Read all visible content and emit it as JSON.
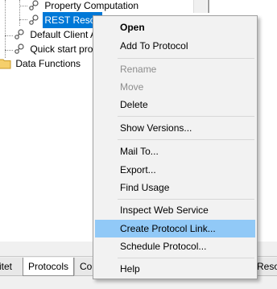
{
  "tree": {
    "items": [
      {
        "label": "Property Computation"
      },
      {
        "label": "REST Resou"
      },
      {
        "label": "Default Client A"
      },
      {
        "label": "Quick start pro"
      },
      {
        "label": "Data Functions"
      }
    ]
  },
  "tabs": [
    {
      "label": "itet"
    },
    {
      "label": "Protocols"
    },
    {
      "label": "Co"
    },
    {
      "label": "Resou"
    }
  ],
  "menu": {
    "items": [
      {
        "label": "Open"
      },
      {
        "label": "Add To Protocol"
      },
      {
        "label": "Rename"
      },
      {
        "label": "Move"
      },
      {
        "label": "Delete"
      },
      {
        "label": "Show Versions..."
      },
      {
        "label": "Mail To..."
      },
      {
        "label": "Export..."
      },
      {
        "label": "Find Usage"
      },
      {
        "label": "Inspect Web Service"
      },
      {
        "label": "Create Protocol Link..."
      },
      {
        "label": "Schedule Protocol..."
      },
      {
        "label": "Help"
      }
    ]
  },
  "colors": {
    "selection": "#0078d7",
    "menu_highlight": "#91c9f7",
    "menu_bg": "#f2f2f2",
    "disabled_text": "#8d8d8d"
  }
}
